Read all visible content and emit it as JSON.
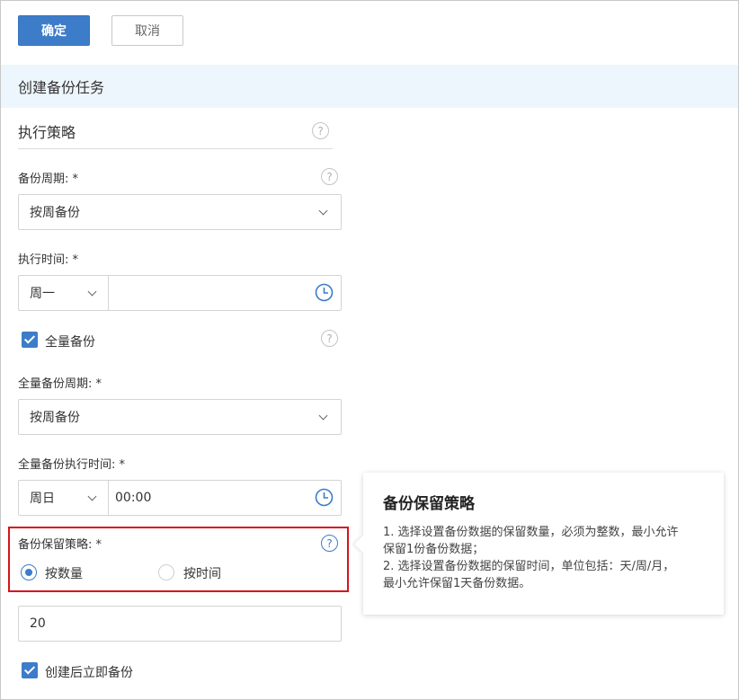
{
  "toolbar": {
    "confirm_label": "确定",
    "cancel_label": "取消"
  },
  "section": {
    "title": "创建备份任务"
  },
  "policy": {
    "title": "执行策略"
  },
  "backup_cycle": {
    "label": "备份周期: *",
    "value": "按周备份"
  },
  "exec_time": {
    "label": "执行时间: *",
    "day": "周一",
    "time": ""
  },
  "full_backup": {
    "label": "全量备份",
    "checked": true
  },
  "full_cycle": {
    "label": "全量备份周期: *",
    "value": "按周备份"
  },
  "full_exec_time": {
    "label": "全量备份执行时间: *",
    "day": "周日",
    "time": "00:00"
  },
  "retention": {
    "label": "备份保留策略: *",
    "option_count": "按数量",
    "option_time": "按时间",
    "selected": "按数量",
    "value": "20"
  },
  "immediate": {
    "label": "创建后立即备份",
    "checked": true
  },
  "popover": {
    "title": "备份保留策略",
    "line1a": "1. 选择设置备份数据的保留数量，必须为整数，最小允许",
    "line1b": "保留1份备份数据；",
    "line2a": "2. 选择设置备份数据的保留时间，单位包括：天/周/月，",
    "line2b": "最小允许保留1天备份数据。"
  },
  "colors": {
    "primary": "#3d7cc9",
    "highlight": "#d9121c",
    "section_bg": "#eef6fd"
  },
  "icons": {
    "help": "?"
  }
}
